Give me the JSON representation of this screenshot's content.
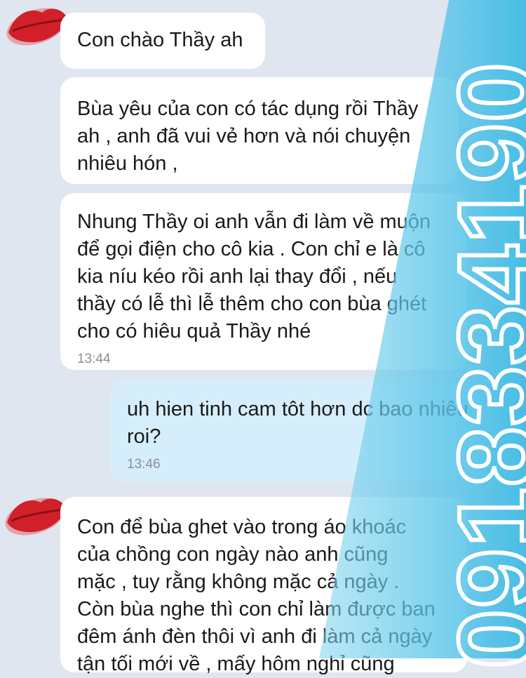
{
  "messages": [
    {
      "sender": "contact",
      "text": "Con chào Thầy ah"
    },
    {
      "sender": "contact",
      "text": "Bùa yêu của con có tác dụng rồi Thầy\nah , anh đã vui vẻ hơn và nói chuyện\nnhiêu hón ,"
    },
    {
      "sender": "contact",
      "text": "Nhung Thầy oi anh vẫn đi làm về muộn\nđể gọi điện cho cô kia . Con chỉ e là cô\nkia níu kéo rồi anh lại thay đổi , nếu\nthầy có lễ thì lễ thêm cho con bùa ghét\ncho có hiêu quả Thầy nhé",
      "time": "13:44"
    },
    {
      "sender": "me",
      "text": "uh hien tinh cam tôt hơn dc bao nhiêu\nroi?",
      "time": "13:46"
    },
    {
      "sender": "contact",
      "text": "Con để bùa ghet vào trong áo khoác\ncủa chồng con ngày nào anh cũng\nmặc , tuy rằng không mặc cả ngày .\nCòn bùa nghe thì con chỉ làm được ban\nđêm ánh đèn thôi vì anh đi làm cả ngày\ntận tối mới về , mấy hôm nghỉ cũng"
    }
  ],
  "watermark": {
    "text": "0918334190",
    "color": "#5bc6e8"
  },
  "colors": {
    "background": "#dfe6f0",
    "incoming_bubble": "#ffffff",
    "outgoing_bubble": "#d6eefb",
    "avatar_lips": "#d1202a"
  }
}
